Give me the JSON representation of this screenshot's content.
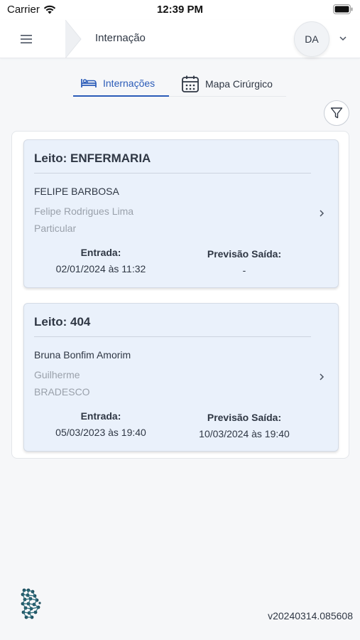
{
  "status_bar": {
    "carrier": "Carrier",
    "time": "12:39 PM"
  },
  "header": {
    "title": "Internação",
    "avatar_initials": "DA"
  },
  "tabs": [
    {
      "label": "Internações",
      "icon": "bed-icon",
      "active": true
    },
    {
      "label": "Mapa Cirúrgico",
      "icon": "calendar-icon",
      "active": false
    }
  ],
  "cards": [
    {
      "title": "Leito: ENFERMARIA",
      "patient": "FELIPE BARBOSA",
      "doctor": "Felipe Rodrigues Lima",
      "insurance": "Particular",
      "entry_label": "Entrada:",
      "entry_value": "02/01/2024 às 11:32",
      "exit_label": "Previsão Saída:",
      "exit_value": "-"
    },
    {
      "title": "Leito: 404",
      "patient": "Bruna Bonfim Amorim",
      "doctor": "Guilherme",
      "insurance": "BRADESCO",
      "entry_label": "Entrada:",
      "entry_value": "05/03/2023 às 19:40",
      "exit_label": "Previsão Saída:",
      "exit_value": "10/03/2024 às 19:40"
    }
  ],
  "footer": {
    "version": "v20240314.085608"
  },
  "colors": {
    "accent": "#2a5bb8",
    "card_bg": "#eaf1fb",
    "muted_text": "#9aa1ab",
    "logo": "#1f4f5f"
  }
}
